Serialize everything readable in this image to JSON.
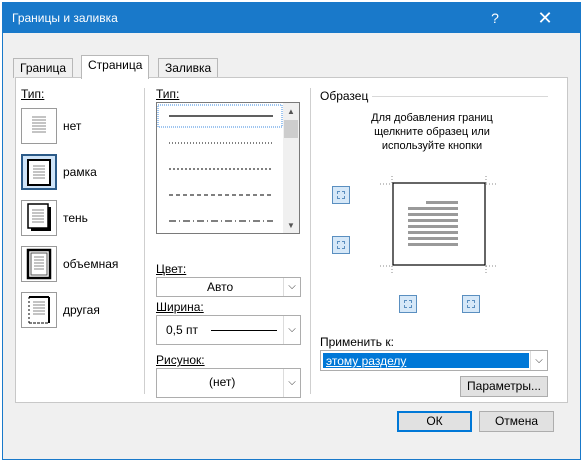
{
  "window": {
    "title": "Границы и заливка",
    "help": "?",
    "close": "✕"
  },
  "tabs": [
    "Граница",
    "Страница",
    "Заливка"
  ],
  "type_section": {
    "label": "Тип:",
    "items": [
      "нет",
      "рамка",
      "тень",
      "объемная",
      "другая"
    ],
    "selected": "рамка"
  },
  "style_section": {
    "label": "Тип:"
  },
  "color": {
    "label": "Цвет:",
    "value": "Авто"
  },
  "width": {
    "label": "Ширина:",
    "value": "0,5 пт"
  },
  "art": {
    "label": "Рисунок:",
    "value": "(нет)"
  },
  "preview": {
    "label": "Образец",
    "hint": "Для добавления границ щелкните образец или используйте кнопки"
  },
  "apply": {
    "label": "Применить к:",
    "value": "этому разделу"
  },
  "buttons": {
    "options": "Параметры...",
    "ok": "ОК",
    "cancel": "Отмена"
  },
  "colors": {
    "accent": "#1979ca",
    "selection": "#0078d7"
  }
}
